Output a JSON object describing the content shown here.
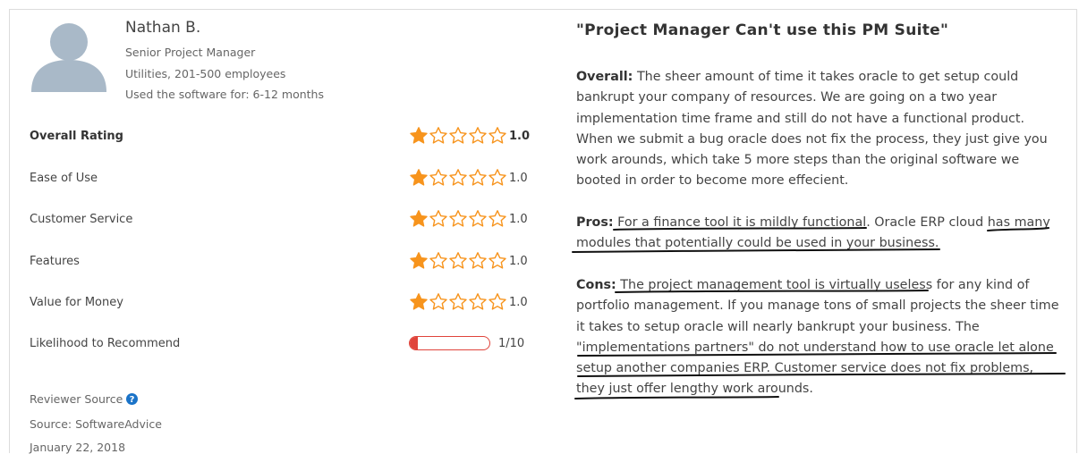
{
  "reviewer": {
    "name": "Nathan B.",
    "title": "Senior Project Manager",
    "company": "Utilities, 201-500 employees",
    "usage": "Used the software for: 6-12 months"
  },
  "ratings": [
    {
      "label": "Overall Rating",
      "value": "1.0",
      "stars": 1
    },
    {
      "label": "Ease of Use",
      "value": "1.0",
      "stars": 1
    },
    {
      "label": "Customer Service",
      "value": "1.0",
      "stars": 1
    },
    {
      "label": "Features",
      "value": "1.0",
      "stars": 1
    },
    {
      "label": "Value for Money",
      "value": "1.0",
      "stars": 1
    }
  ],
  "recommend": {
    "label": "Likelihood to Recommend",
    "value": "1/10",
    "fraction": 0.1
  },
  "source": {
    "label": "Reviewer Source",
    "source_text": "Source: SoftwareAdvice",
    "date": "January 22, 2018"
  },
  "review": {
    "title": "\"Project Manager Can't use this PM Suite\"",
    "overall_label": "Overall:",
    "overall_text": "The sheer amount of time it takes oracle to get setup could bankrupt your company of resources. We are going on a two year implementation time frame and still do not have a functional product. When we submit a bug oracle does not fix the process, they just give you work arounds, which take 5 more steps than the original software we booted in order to become more effecient.",
    "pros_label": "Pros:",
    "pros_parts": [
      "For a finance tool it is mildly functional",
      ". Oracle ERP cloud ",
      "has many modules that potentially could be used in your business",
      "."
    ],
    "cons_label": "Cons:",
    "cons_parts": [
      "The project management tool is virtually useless",
      " for any kind of portfolio management. If you manage tons of small projects the sheer time it takes to setup oracle will nearly bankrupt your business. The \"",
      "implementations partners\" do not understand how to use oracle let alone setup another companies ERP. Customer service does not fix problems, they just offer lengthy work arounds",
      "."
    ]
  },
  "colors": {
    "star": "#f7941d",
    "bar": "#e0443b",
    "help": "#1a73c8"
  },
  "icons": {
    "avatar": "user-avatar-icon",
    "star_filled": "star-filled-icon",
    "star_empty": "star-outline-icon",
    "help": "help-circle-icon"
  }
}
